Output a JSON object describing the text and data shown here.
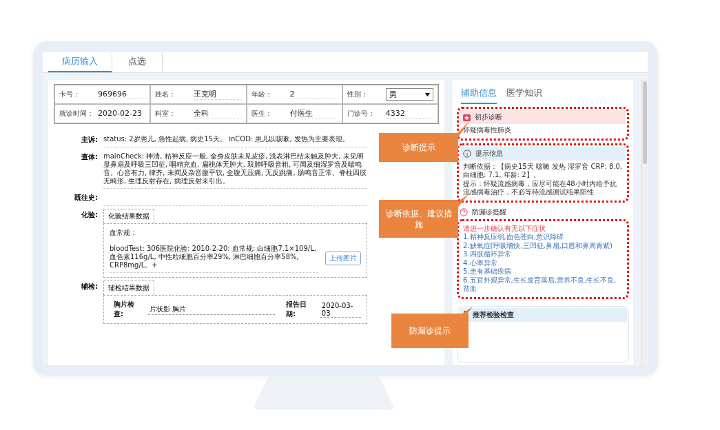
{
  "tabs": [
    {
      "label": "病历输入",
      "selected": true
    },
    {
      "label": "点选",
      "selected": false
    }
  ],
  "patient_fields": [
    {
      "kind": "text",
      "label": "卡号：",
      "value": "969696"
    },
    {
      "kind": "text",
      "label": "姓名：",
      "value": "王克明"
    },
    {
      "kind": "text",
      "label": "年龄：",
      "value": "2"
    },
    {
      "kind": "select",
      "label": "性别：",
      "value": "男"
    },
    {
      "kind": "text",
      "label": "就诊时间：",
      "value": "2020-02-23"
    },
    {
      "kind": "text",
      "label": "科室：",
      "value": "全科"
    },
    {
      "kind": "text",
      "label": "医生：",
      "value": "付医生"
    },
    {
      "kind": "text",
      "label": "门诊号：",
      "value": "4332"
    }
  ],
  "record_sections": [
    {
      "kind": "text",
      "label": "主诉:",
      "text": "status: 2岁患儿, 急性起病, 病史15天。 inCOD: 患儿以咳嗽, 发热为主要表现。"
    },
    {
      "kind": "text",
      "label": "查体:",
      "text": "mainCheck: 神清, 精神反应一般, 全身皮肤未见皮疹, 浅表淋巴结未触及肿大, 未见明显鼻扇及呼吸三凹征, 咽稍充血, 扁桃体无肿大, 双肺呼吸音粗, 可闻及细湿罗音及喘鸣音。心音有力, 律齐, 未闻及杂音腹平软, 全腹无压痛, 无反跳痛, 肠鸣音正常。脊柱四肢无畸形, 生理反射存在, 病理反射未引出。"
    },
    {
      "kind": "empty",
      "label": "既往史:"
    },
    {
      "kind": "lab",
      "label": "化验:",
      "tab": "化验结果数据",
      "subtitle": "血常规：",
      "text": "bloodTest: 306医院化验: 2010-2-20: 血常规: 白细胞7.1×109/L, 血色素116g/L, 中性粒细胞百分率29%, 淋巴细胞百分率58%, CRP8mg/L。+",
      "upload": "上传图片"
    },
    {
      "kind": "exam",
      "label": "辅检:",
      "tab": "辅检结果数据",
      "field_label": "胸片检查:",
      "field_value": "片状影 胸片",
      "date_label": "报告日期:",
      "date_value": "2020-03-03"
    }
  ],
  "side_tabs": [
    {
      "label": "辅助信息",
      "selected": true
    },
    {
      "label": "医学知识",
      "selected": false
    }
  ],
  "side_panels": [
    {
      "kind": "diagnosis",
      "title": "初步诊断",
      "highlighted": true,
      "lines": [
        "怀疑病毒性肺炎"
      ]
    },
    {
      "kind": "info",
      "title": "提示信息",
      "highlighted": true,
      "lines": [
        "判断依据：【病史15天 咳嗽 发热 湿罗音 CRP: 8.0, 白细胞: 7.1, 年龄: 2】。",
        "提示：怀疑流感病毒，应尽可能在48小时内给予抗流感病毒治疗，不必等待流感测试结果阳性"
      ]
    },
    {
      "kind": "checklist",
      "title": "防漏诊提醒",
      "highlighted": true,
      "prompt": "请进一步确认有无以下症状",
      "lines": [
        "1.精神反应弱,面色苍白,意识障碍",
        "2.缺氧症(呼吸增快,三凹征,鼻扇,口唇和鼻周青紫)",
        "3.四肢循环异常",
        "4.心率异常",
        "5.患有基础疾病",
        "6.五官外观异常,生长发育落后,营养不良,生长不良,贫血"
      ]
    },
    {
      "kind": "recommend",
      "title": "推荐检验检查",
      "highlighted": false
    }
  ],
  "callouts": [
    {
      "text": "诊断提示"
    },
    {
      "text": "诊断依据、建议措施"
    },
    {
      "text": "防漏诊提示"
    }
  ]
}
